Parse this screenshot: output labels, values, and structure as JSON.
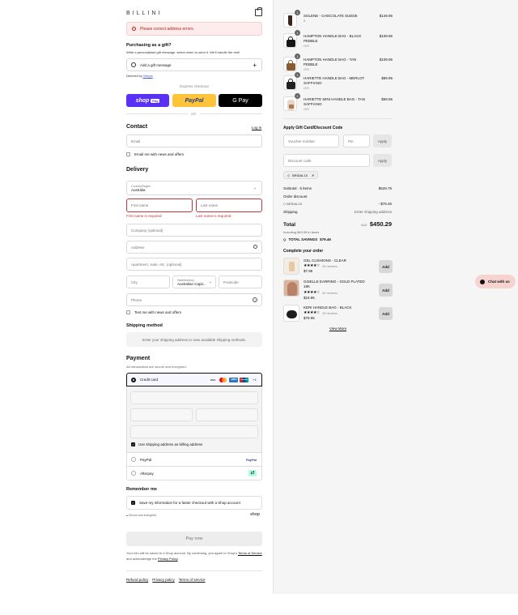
{
  "header": {
    "logo": "BILLINI"
  },
  "error_banner": {
    "text": "Please correct address errors."
  },
  "gift": {
    "title": "Purchasing as a gift?",
    "subtitle": "Write a personalised gift message, select when to send it. We'll handle the rest!",
    "add_label": "Add a gift message",
    "delivered_by_prefix": "Delivered by",
    "delivered_by_link": "Giftoptn"
  },
  "express": {
    "label": "Express checkout",
    "shop": "shop",
    "shop_pay": "Pay",
    "paypal": "PayPal",
    "gpay": "G Pay",
    "or": "OR"
  },
  "contact": {
    "title": "Contact",
    "login": "Log in",
    "email_placeholder": "Email",
    "news_label": "Email me with news and offers"
  },
  "delivery": {
    "title": "Delivery",
    "country_label": "Country/Region",
    "country_value": "Australia",
    "first_name_placeholder": "First name",
    "last_name_placeholder": "Last name",
    "first_name_error": "First name is required",
    "last_name_error": "Last name is required",
    "company_placeholder": "Company (optional)",
    "address_placeholder": "Address",
    "apartment_placeholder": "Apartment, suite, etc. (optional)",
    "city_placeholder": "City",
    "state_label": "State/territory",
    "state_value": "Australian Capit...",
    "postcode_placeholder": "Postcode",
    "phone_placeholder": "Phone",
    "text_label": "Text me with news and offers"
  },
  "shipping": {
    "title": "Shipping method",
    "message": "Enter your shipping address to view available shipping methods."
  },
  "payment": {
    "title": "Payment",
    "subtitle": "All transactions are secure and encrypted.",
    "credit_card": "Credit card",
    "more_cards": "+1",
    "card_brands": [
      "VISA",
      "MC",
      "AMEX",
      "UnionPay"
    ],
    "billing_label": "Use shipping address as billing address",
    "paypal": "PayPal",
    "paypal_logo": "PayPal",
    "afterpay": "Afterpay"
  },
  "remember": {
    "title": "Remember me",
    "save_label": "Save my information for a faster checkout with a Shop account",
    "secure": "Secure and encrypted",
    "shop": "shop"
  },
  "pay_now": "Pay now",
  "legal": {
    "text1": "Your info will be saved to a Shop account. By continuing, you agree to Shop's",
    "terms": "Terms of Service",
    "text2": "and acknowledge the",
    "privacy": "Privacy Policy",
    "end": "."
  },
  "footer_links": [
    "Refund policy",
    "Privacy policy",
    "Terms of service"
  ],
  "cart": {
    "items": [
      {
        "qty": "1",
        "name": "SOLENE - CHOCOLATE SUEDE",
        "variant": "5",
        "price": "$149.95"
      },
      {
        "qty": "1",
        "name": "HAMPTON HANDLE BAG - BLACK PEBBLE",
        "variant": "O/S",
        "price": "$109.95"
      },
      {
        "qty": "1",
        "name": "HAMPTON HANDLE BAG - TAN PEBBLE",
        "variant": "O/S",
        "price": "$109.95"
      },
      {
        "qty": "1",
        "name": "HARIETTE HANDLE BAG - MERLOT SAFFIANO",
        "variant": "O/S",
        "price": "$89.95"
      },
      {
        "qty": "1",
        "name": "HARIETTE MINI HANDLE BAG - TAN SAFFIANO",
        "variant": "O/S",
        "price": "$69.95"
      }
    ],
    "gift_title": "Apply Gift Card/Discount Code",
    "voucher_placeholder": "Voucher number",
    "pin_placeholder": "Pin",
    "apply": "Apply",
    "discount_placeholder": "Discount code",
    "discount_tag": "BRIDAL15",
    "subtotal_label": "Subtotal · 5 items",
    "subtotal_value": "$529.75",
    "order_discount_label": "Order discount",
    "order_discount_code": "BRIDAL15",
    "order_discount_value": "- $79.46",
    "shipping_label": "Shipping",
    "shipping_value": "Enter shipping address",
    "total_label": "Total",
    "currency": "AUD",
    "total_value": "$450.29",
    "taxes": "Including $40.95 in taxes",
    "savings_label": "TOTAL SAVINGS",
    "savings_value": "$79.46"
  },
  "complete": {
    "title": "Complete your order",
    "items": [
      {
        "name": "GEL CUSHIONS - CLEAR",
        "reviews": "29 reviews",
        "price": "$7.95",
        "add": "Add"
      },
      {
        "name": "GISELLE EARRING - GOLD PLATED 18K",
        "reviews": "36 reviews",
        "price": "$19.95",
        "add": "Add"
      },
      {
        "name": "KERI HANDLE BAG - BLACK",
        "reviews": "18 reviews",
        "price": "$79.95",
        "add": "Add"
      }
    ],
    "view_more": "View More"
  },
  "chat": {
    "label": "Chat with us"
  }
}
